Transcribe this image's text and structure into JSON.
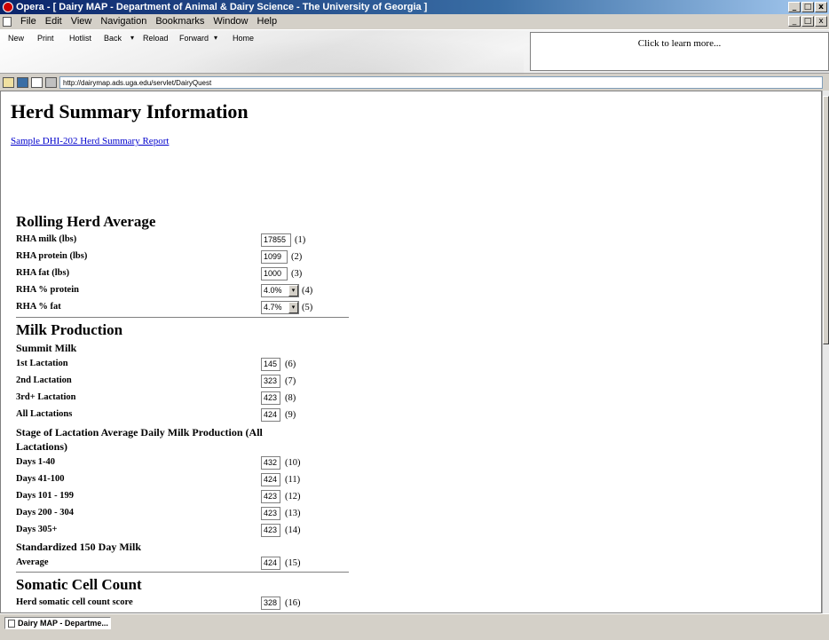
{
  "window": {
    "title": "Opera - [ Dairy MAP - Department of Animal & Dairy Science - The University of Georgia ]",
    "controls": [
      "_",
      "□",
      "x"
    ]
  },
  "menu": [
    "File",
    "Edit",
    "View",
    "Navigation",
    "Bookmarks",
    "Window",
    "Help"
  ],
  "toolbar": {
    "new": "New",
    "print": "Print",
    "hotlist": "Hotlist",
    "back": "Back",
    "reload": "Reload",
    "forward": "Forward",
    "home": "Home",
    "dropdown": "▾",
    "ad_text": "Click to learn more..."
  },
  "address": {
    "url": "http://dairymap.ads.uga.edu/servlet/DairyQuest"
  },
  "page": {
    "title": "Herd Summary Information",
    "sample_link": "Sample DHI-202 Herd Summary Report",
    "rha": {
      "heading": "Rolling Herd Average",
      "rows": [
        {
          "label": "RHA milk (lbs)",
          "value": "17855",
          "num": "(1)"
        },
        {
          "label": "RHA protein (lbs)",
          "value": "1099",
          "num": "(2)"
        },
        {
          "label": "RHA fat (lbs)",
          "value": "1000",
          "num": "(3)"
        },
        {
          "label": "RHA % protein",
          "value": "4.0%",
          "num": "(4)"
        },
        {
          "label": "RHA % fat",
          "value": "4.7%",
          "num": "(5)"
        }
      ]
    },
    "milk": {
      "heading": "Milk Production",
      "summit_heading": "Summit Milk",
      "summit_rows": [
        {
          "label": "1st Lactation",
          "value": "145",
          "num": "(6)"
        },
        {
          "label": "2nd Lactation",
          "value": "323",
          "num": "(7)"
        },
        {
          "label": "3rd+ Lactation",
          "value": "423",
          "num": "(8)"
        },
        {
          "label": "All Lactations",
          "value": "424",
          "num": "(9)"
        }
      ],
      "stage_heading_1": "Stage of Lactation Average Daily Milk Production (All",
      "stage_heading_2": "Lactations)",
      "stage_rows": [
        {
          "label": "Days 1-40",
          "value": "432",
          "num": "(10)"
        },
        {
          "label": "Days 41-100",
          "value": "424",
          "num": "(11)"
        },
        {
          "label": "Days 101 - 199",
          "value": "423",
          "num": "(12)"
        },
        {
          "label": "Days 200 - 304",
          "value": "423",
          "num": "(13)"
        },
        {
          "label": "Days 305+",
          "value": "423",
          "num": "(14)"
        }
      ],
      "std_heading": "Standardized 150 Day Milk",
      "std_rows": [
        {
          "label": "Average",
          "value": "424",
          "num": "(15)"
        }
      ]
    },
    "scc": {
      "heading": "Somatic Cell Count",
      "rows": [
        {
          "label": "Herd somatic cell count score",
          "value": "328",
          "num": "(16)"
        }
      ]
    }
  },
  "status": {
    "task_label": "Dairy MAP - Departme..."
  }
}
